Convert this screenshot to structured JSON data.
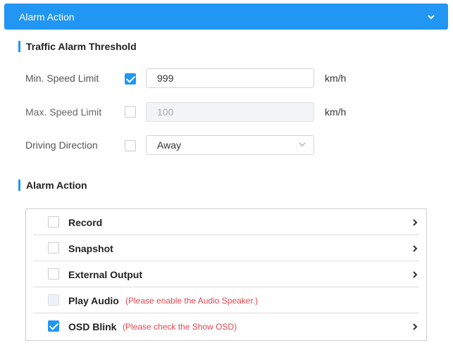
{
  "header": {
    "title": "Alarm Action",
    "toggle_icon": "chevron-down-icon"
  },
  "threshold": {
    "title": "Traffic Alarm Threshold",
    "min_speed": {
      "label": "Min. Speed Limit",
      "checked": true,
      "value": "999",
      "unit": "km/h"
    },
    "max_speed": {
      "label": "Max. Speed Limit",
      "checked": false,
      "value": "100",
      "unit": "km/h"
    },
    "direction": {
      "label": "Driving Direction",
      "checked": false,
      "value": "Away"
    }
  },
  "alarm_action": {
    "title": "Alarm Action",
    "items": [
      {
        "label": "Record",
        "checked": false,
        "note": "",
        "has_arrow": true
      },
      {
        "label": "Snapshot",
        "checked": false,
        "note": "",
        "has_arrow": true
      },
      {
        "label": "External Output",
        "checked": false,
        "note": "",
        "has_arrow": true
      },
      {
        "label": "Play Audio",
        "checked": false,
        "disabled": true,
        "note": "(Please enable the Audio Speaker.)",
        "has_arrow": false
      },
      {
        "label": "OSD Blink",
        "checked": true,
        "note": "(Please check the Show OSD)",
        "has_arrow": true
      }
    ]
  },
  "colors": {
    "accent": "#2196f3",
    "warning": "#e0464f"
  }
}
